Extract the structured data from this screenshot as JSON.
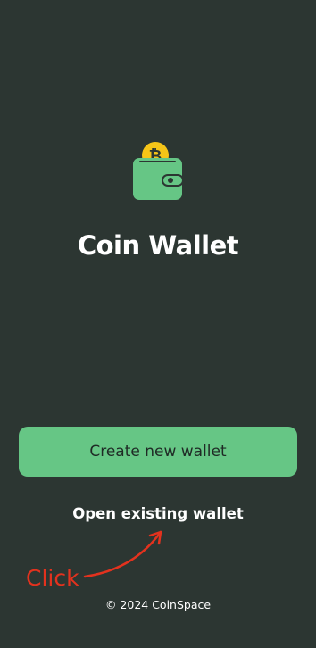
{
  "app": {
    "title": "Coin Wallet",
    "logo_icon": "wallet-bitcoin-icon"
  },
  "actions": {
    "create_label": "Create new wallet",
    "open_label": "Open existing wallet"
  },
  "annotation": {
    "text": "Click",
    "color": "#e3321e"
  },
  "footer": {
    "text": "© 2024 CoinSpace"
  },
  "colors": {
    "background": "#2c3632",
    "accent": "#66c685",
    "coin": "#f5c518",
    "text": "#ffffff"
  }
}
